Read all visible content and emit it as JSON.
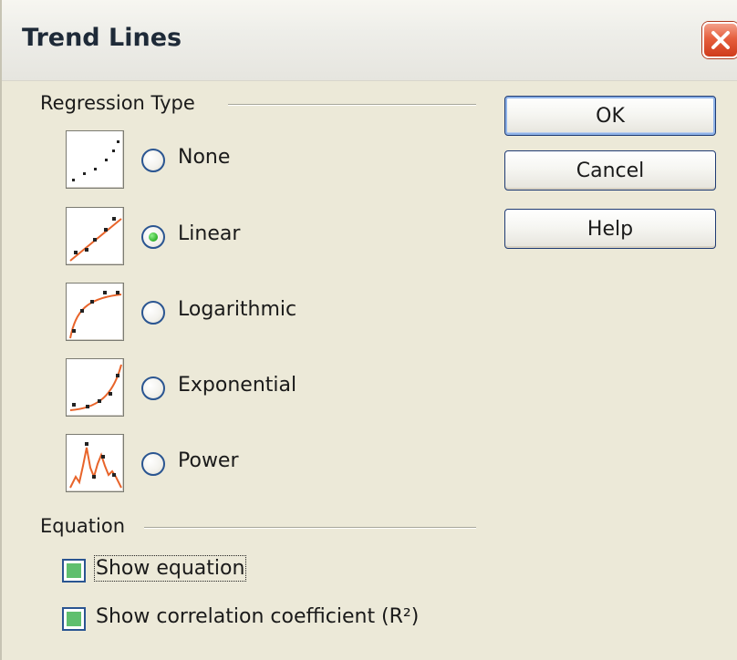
{
  "window": {
    "title": "Trend Lines",
    "close_icon": "close-x-icon"
  },
  "regression": {
    "group_label": "Regression Type",
    "options": [
      {
        "label": "None",
        "icon": "regression-none-icon",
        "checked": false
      },
      {
        "label": "Linear",
        "icon": "regression-linear-icon",
        "checked": true
      },
      {
        "label": "Logarithmic",
        "icon": "regression-logarithmic-icon",
        "checked": false
      },
      {
        "label": "Exponential",
        "icon": "regression-exponential-icon",
        "checked": false
      },
      {
        "label": "Power",
        "icon": "regression-power-icon",
        "checked": false
      }
    ]
  },
  "equation": {
    "group_label": "Equation",
    "show_equation": {
      "label": "Show equation",
      "checked": true
    },
    "show_correlation": {
      "label": "Show correlation coefficient (R²)",
      "checked": true
    }
  },
  "buttons": {
    "ok": "OK",
    "cancel": "Cancel",
    "help": "Help"
  },
  "colors": {
    "trend_line": "#e8642a",
    "check_fill": "#5fbf6e",
    "radio_dot": "#2fb12a",
    "close_button": "#e65f3e"
  }
}
